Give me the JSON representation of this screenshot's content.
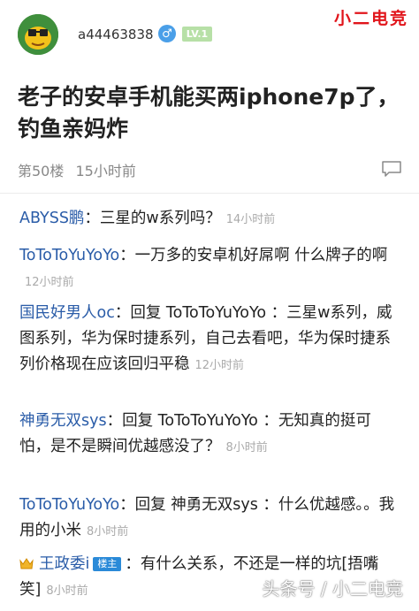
{
  "watermark": "小二电竞",
  "user": {
    "name": "a44463838",
    "gender_icon": "male-icon",
    "level": "LV.1"
  },
  "post": {
    "title": "老子的安卓手机能买两iphone7p了，钓鱼亲妈炸",
    "floor": "第50楼",
    "time": "15小时前"
  },
  "comments": [
    {
      "author": "ABYSS鹏",
      "text": "：三星的w系列吗？",
      "time": "14小时前"
    },
    {
      "author": "ToToToYuYoYo",
      "text": "：一万多的安卓机好屌啊 什么牌子的啊",
      "time": "12小时前"
    },
    {
      "author": "国民好男人oc",
      "text": "：回复 ToToToYuYoYo ：三星w系列，威图系列，华为保时捷系列，自己去看吧，华为保时捷系列价格现在应该回归平稳",
      "time": "12小时前"
    },
    {
      "author": "神勇无双sys",
      "text": "：回复 ToToToYuYoYo ：无知真的挺可怕，是不是瞬间优越感没了？",
      "time": "8小时前"
    },
    {
      "author": "ToToToYuYoYo",
      "text": "：回复 神勇无双sys ：什么优越感。。我用的小米",
      "time": "8小时前"
    },
    {
      "author": "王政委i",
      "badge": "楼主",
      "text": "：有什么关系，不还是一样的坑[捂嘴笑]",
      "time": "8小时前"
    }
  ],
  "footer_watermark": "头条号 / 小二电竞"
}
